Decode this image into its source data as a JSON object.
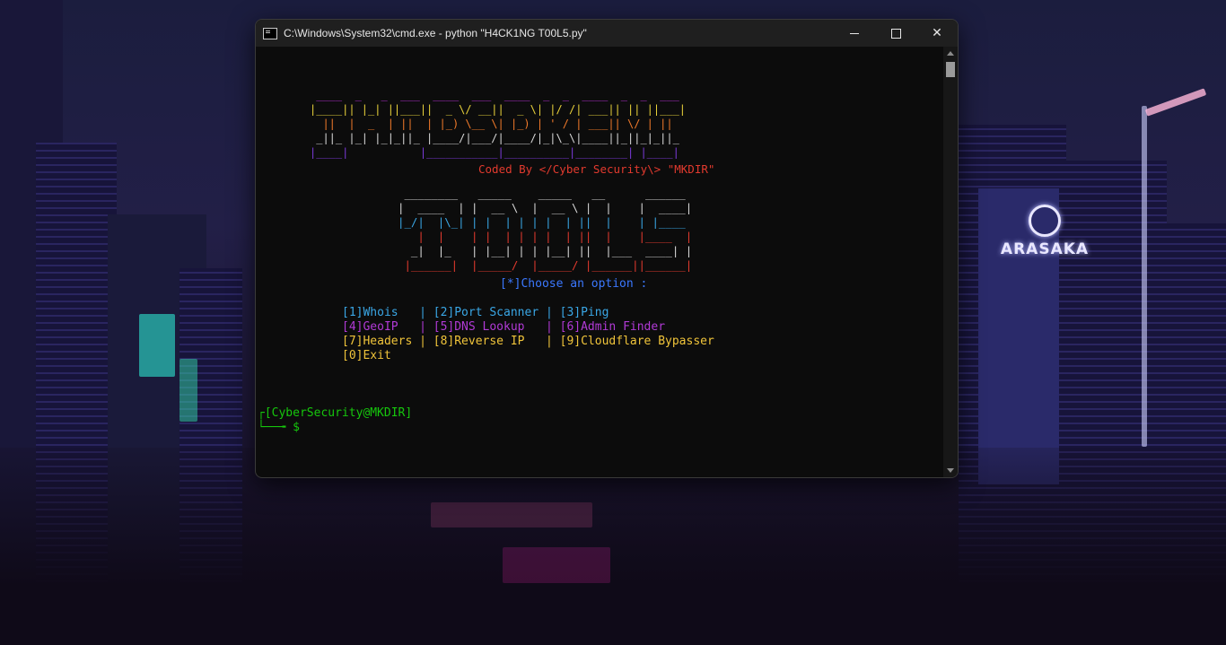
{
  "window": {
    "title": "C:\\Windows\\System32\\cmd.exe - python  \"H4CK1NG T00L5.py\""
  },
  "banner_lines": [
    " ____  _   _  ___  ____  ___  ____  _  _  ____  _  _  ___  ",
    "|____|| |_| ||___||  _ \\/ __||  _ \\| |/ /| ___|| || ||___| ",
    "  ||  |  _  | ||  | |_) \\__ \\| |_) | ' / | ___|| \\/ | ||   ",
    " _||_ |_| |_|_||_ |____/|___/|____/|_|\\_\\|____||_||_|_||_  ",
    "|____|           |___________|__________|________| |____|  "
  ],
  "credit": "Coded By </Cyber Security\\> \"MKDIR\"",
  "tools_lines": [
    " ________   _____    _____   __      ______ ",
    "|  ____  | |  __ \\  |  __ \\ |  |    |  ____|",
    "|_/|  |\\_| | |  | | | |  | ||  |    | |____ ",
    "   |  |    | |  | | | |  | ||  |    |____  |",
    "  _|  |_   | |__| | | |__| ||  |___  ____| |",
    " |______|  |_____/  |_____/ |______||______|"
  ],
  "menu": {
    "prompt": "[*]Choose an option :",
    "rows": [
      "[1]Whois   | [2]Port Scanner | [3]Ping",
      "[4]GeoIP   | [5]DNS Lookup   | [6]Admin Finder",
      "[7]Headers | [8]Reverse IP   | [9]Cloudflare Bypasser",
      "[0]Exit"
    ]
  },
  "shell": {
    "user_line": "┌[CyberSecurity@MKDIR]",
    "input_line": "└──╼ $"
  },
  "wallpaper": {
    "logo_text": "ARASAKA"
  },
  "colors": {
    "banner_gradient": [
      "#b12fd0",
      "#e8d13a",
      "#f07a2a",
      "#d8d8d8",
      "#7a3ad8"
    ],
    "credit": "#e23a2e",
    "tools_gradient": [
      "#d8d8d8",
      "#3aa7e6",
      "#d8d8d8",
      "#f0c43a",
      "#d8d8d8",
      "#e23a2e"
    ],
    "prompt": "#3b78ff",
    "row_colors": [
      "#3aa7e6",
      "#b13ad6",
      "#f0c43a",
      "#f0c43a"
    ],
    "shell": "#16c60c"
  }
}
